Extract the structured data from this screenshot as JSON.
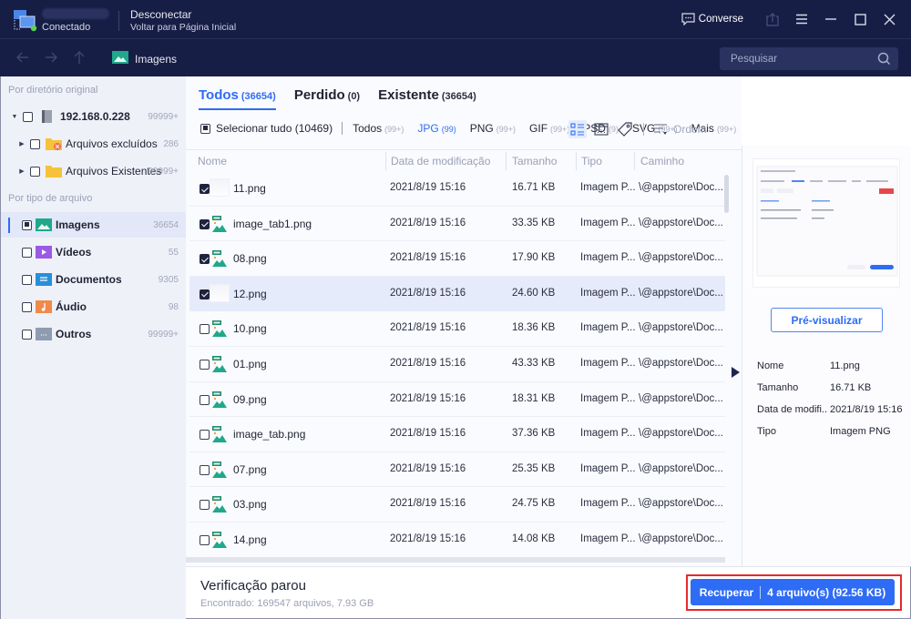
{
  "titlebar": {
    "status": "Conectado",
    "disconnect_label": "Desconectar",
    "home_label": "Voltar para Página Inicial",
    "chat_label": "Converse"
  },
  "navbar": {
    "path_label": "Imagens",
    "search_placeholder": "Pesquisar"
  },
  "sidebar": {
    "by_directory_heading": "Por diretório original",
    "tree": [
      {
        "label": "192.168.0.228",
        "count": "99999+"
      },
      {
        "label": "Arquivos excluídos",
        "count": "286"
      },
      {
        "label": "Arquivos Existentes",
        "count": "99999+"
      }
    ],
    "by_type_heading": "Por tipo de arquivo",
    "types": [
      {
        "label": "Imagens",
        "count": "36654",
        "active": true
      },
      {
        "label": "Vídeos",
        "count": "55"
      },
      {
        "label": "Documentos",
        "count": "9305"
      },
      {
        "label": "Áudio",
        "count": "98"
      },
      {
        "label": "Outros",
        "count": "99999+"
      }
    ]
  },
  "tabs": [
    {
      "label": "Todos",
      "count": "(36654)",
      "active": true
    },
    {
      "label": "Perdido",
      "count": "(0)"
    },
    {
      "label": "Existente",
      "count": "(36654)"
    }
  ],
  "filters": {
    "select_all_label": "Selecionar tudo (10469)",
    "types": [
      {
        "label": "Todos",
        "count": "(99+)"
      },
      {
        "label": "JPG",
        "count": "(99)",
        "active": true
      },
      {
        "label": "PNG",
        "count": "(99+)"
      },
      {
        "label": "GIF",
        "count": "(99+)"
      },
      {
        "label": "PSD",
        "count": "(9)"
      },
      {
        "label": "SVG",
        "count": "(99+)"
      },
      {
        "label": "Mais",
        "count": "(99+)"
      }
    ],
    "order_label": "Ordem"
  },
  "table": {
    "columns": [
      "Nome",
      "Data de modificação",
      "Tamanho",
      "Tipo",
      "Caminho"
    ],
    "rows": [
      {
        "name": "11.png",
        "date": "2021/8/19 15:16",
        "size": "16.71 KB",
        "type": "Imagem P...",
        "path": "\\@appstore\\Doc...",
        "checked": true,
        "thumb": true
      },
      {
        "name": "image_tab1.png",
        "date": "2021/8/19 15:16",
        "size": "33.35 KB",
        "type": "Imagem P...",
        "path": "\\@appstore\\Doc...",
        "checked": true
      },
      {
        "name": "08.png",
        "date": "2021/8/19 15:16",
        "size": "17.90 KB",
        "type": "Imagem P...",
        "path": "\\@appstore\\Doc...",
        "checked": true
      },
      {
        "name": "12.png",
        "date": "2021/8/19 15:16",
        "size": "24.60 KB",
        "type": "Imagem P...",
        "path": "\\@appstore\\Doc...",
        "checked": true,
        "thumb": true,
        "selected": true
      },
      {
        "name": "10.png",
        "date": "2021/8/19 15:16",
        "size": "18.36 KB",
        "type": "Imagem P...",
        "path": "\\@appstore\\Doc..."
      },
      {
        "name": "01.png",
        "date": "2021/8/19 15:16",
        "size": "43.33 KB",
        "type": "Imagem P...",
        "path": "\\@appstore\\Doc..."
      },
      {
        "name": "09.png",
        "date": "2021/8/19 15:16",
        "size": "18.31 KB",
        "type": "Imagem P...",
        "path": "\\@appstore\\Doc..."
      },
      {
        "name": "image_tab.png",
        "date": "2021/8/19 15:16",
        "size": "37.36 KB",
        "type": "Imagem P...",
        "path": "\\@appstore\\Doc..."
      },
      {
        "name": "07.png",
        "date": "2021/8/19 15:16",
        "size": "25.35 KB",
        "type": "Imagem P...",
        "path": "\\@appstore\\Doc..."
      },
      {
        "name": "03.png",
        "date": "2021/8/19 15:16",
        "size": "24.75 KB",
        "type": "Imagem P...",
        "path": "\\@appstore\\Doc..."
      },
      {
        "name": "14.png",
        "date": "2021/8/19 15:16",
        "size": "14.08 KB",
        "type": "Imagem P...",
        "path": "\\@appstore\\Doc..."
      }
    ]
  },
  "preview": {
    "button_label": "Pré-visualizar",
    "info": [
      {
        "key": "Nome",
        "value": "11.png"
      },
      {
        "key": "Tamanho",
        "value": "16.71 KB"
      },
      {
        "key": "Data de modifi..",
        "value": "2021/8/19 15:16"
      },
      {
        "key": "Tipo",
        "value": "Imagem PNG"
      }
    ]
  },
  "footer": {
    "status_title": "Verificação parou",
    "status_detail": "Encontrado: 169547 arquivos, 7.93 GB",
    "recover_label": "Recuperar",
    "recover_detail": "4 arquivo(s) (92.56 KB)"
  },
  "colors": {
    "titlebar_bg": "#171e45",
    "accent": "#2f6cf5",
    "highlight_outline": "#e52a2a"
  }
}
